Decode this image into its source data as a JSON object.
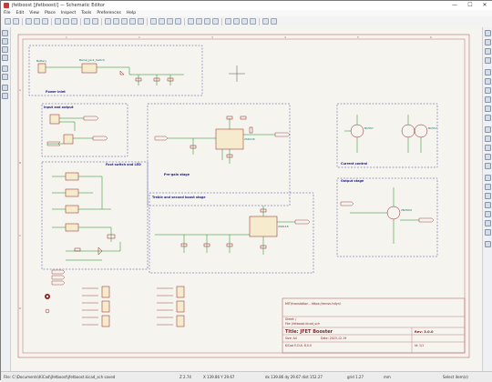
{
  "window": {
    "title": "jfetboost [jfetboost/] — Schematic Editor",
    "controls": {
      "minimize": "—",
      "maximize": "☐",
      "close": "✕"
    }
  },
  "menu": [
    "File",
    "Edit",
    "View",
    "Place",
    "Inspect",
    "Tools",
    "Preferences",
    "Help"
  ],
  "sheet": {
    "blocks": {
      "power": "Power inlet",
      "io": "Input and output",
      "footswitch": "Foot switch and LED",
      "pregain": "Pre-gain stage",
      "tone": "Treble and second boost stage",
      "current": "Current control",
      "output": "Output stage"
    },
    "title_block": {
      "license": "MIT/translation - https://mnsn.hdyn/",
      "sheet": "Sheet: /",
      "file": "File: jfetboost.kicad_sch",
      "title": "Title: JFET Booster",
      "size": "Size: A4",
      "date": "Date: 2023-12-19",
      "rev": "Rev: 3.0.0",
      "kicad": "KiCad E.D.A. 8.0.0",
      "id": "Id: 1/1"
    },
    "components": {
      "battery": "Battery",
      "barrel": "Barrel_Jack_Switch",
      "q1": "2SK118",
      "q2": "2SK118",
      "q3": "BC547",
      "q4": "BC557",
      "q5": "BC557",
      "q6": "2N3904"
    },
    "nets": [
      "INPUT",
      "OUTPUT",
      "VCC",
      "GND",
      "TREBLE_IN",
      "BOOST_OUT"
    ]
  },
  "status": {
    "path": "File: C:\\Documents\\KiCad\\jfetboost\\jfetboost.kicad_sch saved",
    "zoom": "Z 2.74",
    "xy": "X 139.86  Y 29.67",
    "dxdy": "dx 139.86  dy 29.67  dist 152.27",
    "grid": "grid 1.27",
    "units": "mm",
    "tool": "Select item(s)"
  }
}
